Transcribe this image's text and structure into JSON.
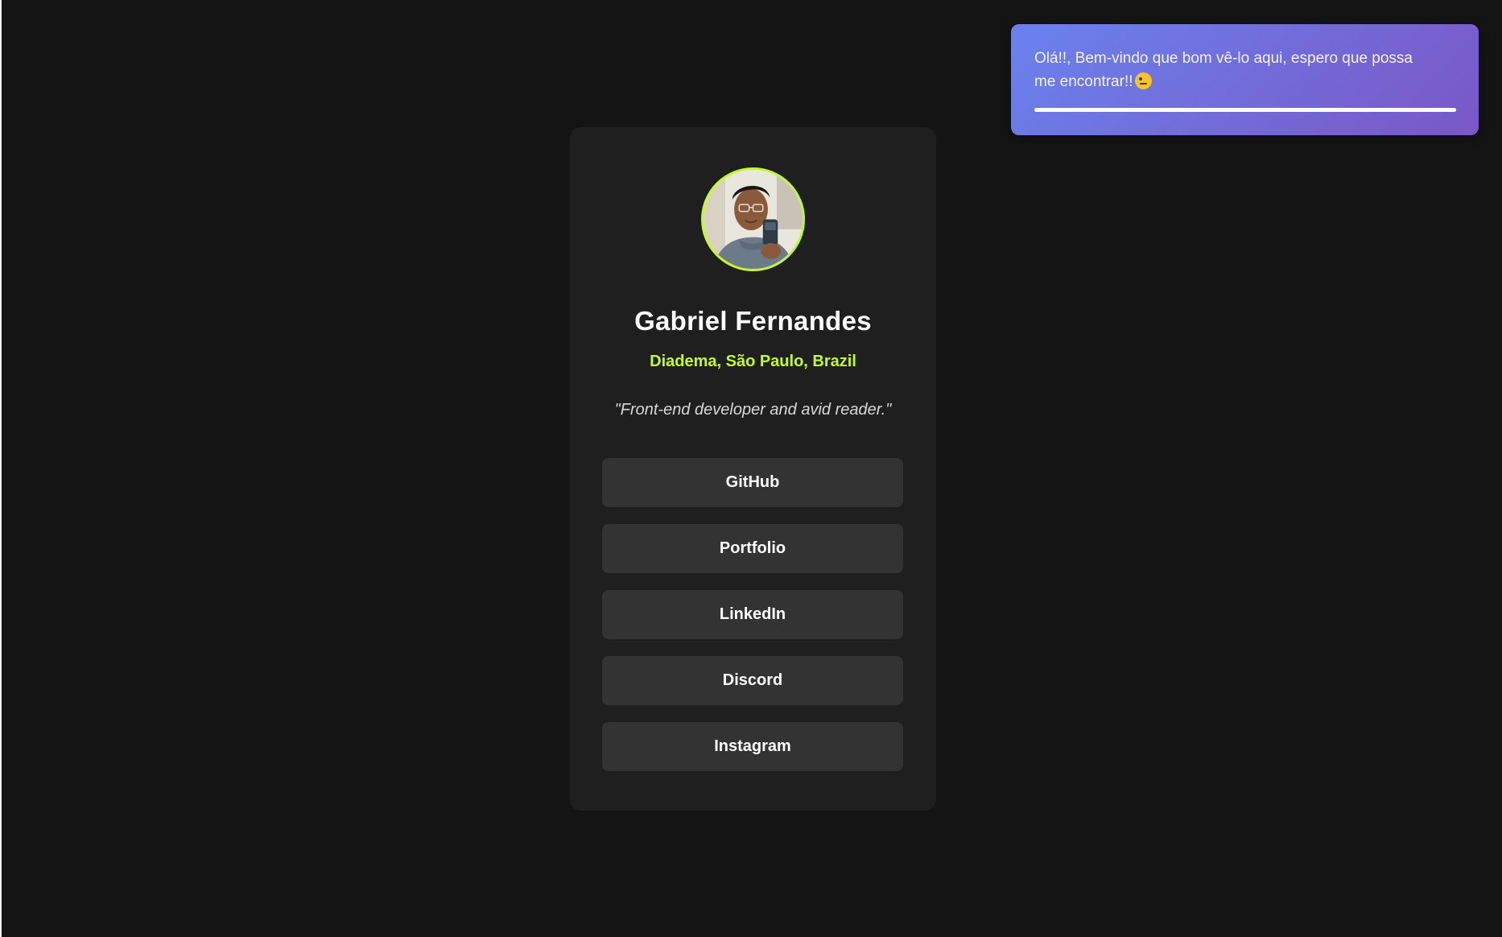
{
  "toast": {
    "message": "Olá!!, Bem-vindo que bom vê-lo aqui, espero que possa me encontrar!!",
    "emoji": "winking-face-icon",
    "progress": 1.0,
    "gradient": [
      "#6a82ee",
      "#7a57c6"
    ]
  },
  "profile": {
    "name": "Gabriel Fernandes",
    "location": "Diadema, São Paulo, Brazil",
    "bio": "\"Front-end developer and avid reader.\"",
    "accent_color": "#c5f82a"
  },
  "links": [
    {
      "label": "GitHub"
    },
    {
      "label": "Portfolio"
    },
    {
      "label": "LinkedIn"
    },
    {
      "label": "Discord"
    },
    {
      "label": "Instagram"
    }
  ],
  "colors": {
    "background": "#141414",
    "card": "#1f1f1f",
    "button": "#333333"
  }
}
